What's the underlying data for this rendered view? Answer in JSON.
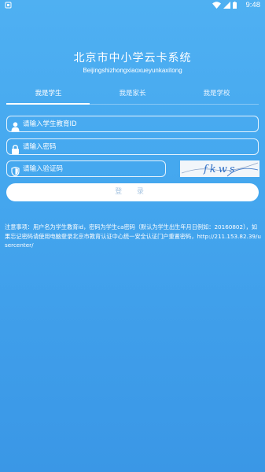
{
  "status_bar": {
    "time": "9:48"
  },
  "header": {
    "title": "北京市中小学云卡系统",
    "subtitle": "Beijingshizhongxiaoxueyunkaxitong"
  },
  "tabs": [
    {
      "label": "我是学生",
      "active": true
    },
    {
      "label": "我是家长",
      "active": false
    },
    {
      "label": "我是学校",
      "active": false
    }
  ],
  "form": {
    "education_id": {
      "placeholder": "请输入学生教育ID",
      "icon": "user-icon"
    },
    "password": {
      "placeholder": "请输入密码",
      "icon": "lock-icon"
    },
    "captcha_input": {
      "placeholder": "请输入验证码",
      "icon": "shield-icon"
    },
    "captcha_text": "fkws",
    "login_label": "登 录"
  },
  "notice": "注意事项：用户名为学生教育id，密码为学生ca密码（默认为学生出生年月日例如：20160802），如果忘记密码请使用电脑登录北京市教育认证中心统一安全认证门户重置密码，http://211.153.82.39/usercenter/",
  "colors": {
    "background_top": "#4fb0f2",
    "background_bottom": "#3a97e6",
    "button_text": "#a9c6e2"
  }
}
